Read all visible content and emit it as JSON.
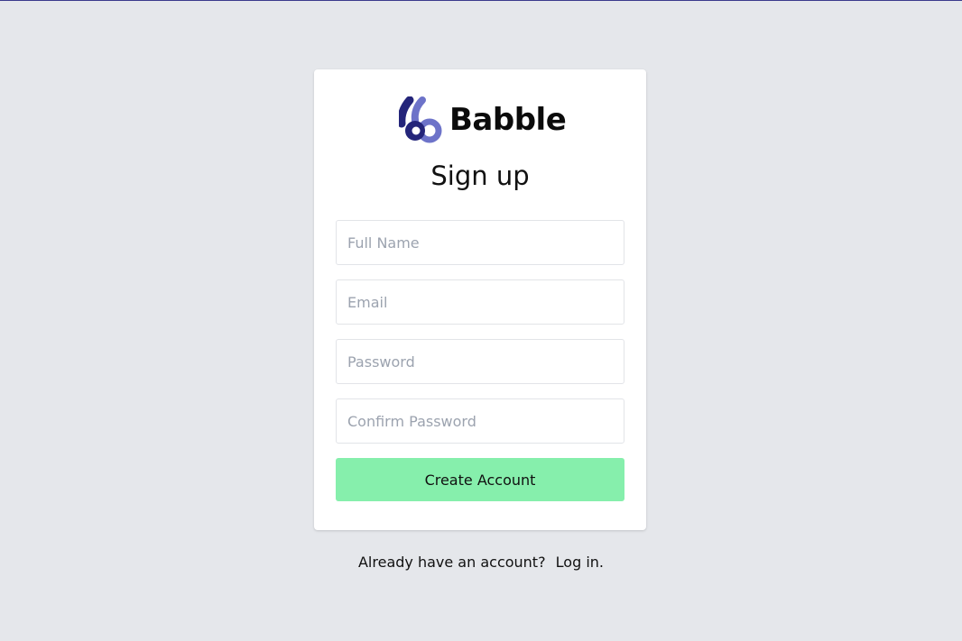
{
  "brand": {
    "name": "Babble",
    "logo_icon": "babble-logo-icon",
    "logo_colors": {
      "primary": "#24257a",
      "secondary": "#6d73c9"
    }
  },
  "form": {
    "title": "Sign up",
    "fields": [
      {
        "placeholder": "Full Name",
        "value": ""
      },
      {
        "placeholder": "Email",
        "value": ""
      },
      {
        "placeholder": "Password",
        "value": ""
      },
      {
        "placeholder": "Confirm Password",
        "value": ""
      }
    ],
    "submit_label": "Create Account",
    "submit_color": "#86efac"
  },
  "footer": {
    "prompt": "Already have an account?",
    "link_label": "Log in."
  },
  "colors": {
    "background": "#e5e7eb",
    "card": "#ffffff"
  }
}
